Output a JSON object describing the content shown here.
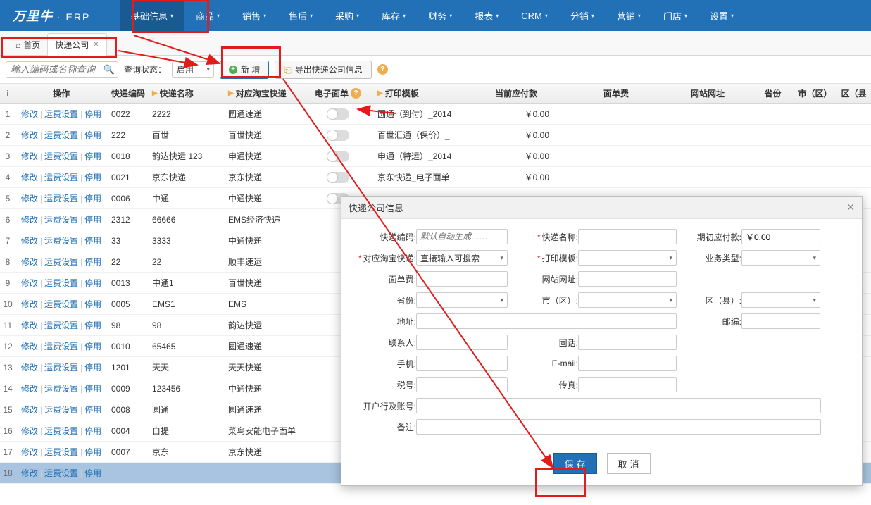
{
  "app": {
    "logo": "万里牛",
    "sub": "· ERP"
  },
  "nav": [
    "基础信息",
    "商品",
    "销售",
    "售后",
    "采购",
    "库存",
    "财务",
    "报表",
    "CRM",
    "分销",
    "营销",
    "门店",
    "设置"
  ],
  "navActiveIndex": 0,
  "tabs": {
    "home": "首页",
    "current": "快递公司"
  },
  "toolbar": {
    "searchPlaceholder": "输入编码或名称查询",
    "statusLabel": "查询状态：",
    "statusValue": "启用",
    "addLabel": "新 增",
    "exportLabel": "导出快递公司信息"
  },
  "columns": {
    "op": "操作",
    "code": "快递编码",
    "name": "快递名称",
    "tb": "对应淘宝快递",
    "ed": "电子面单",
    "tmpl": "打印模板",
    "pay": "当前应付款",
    "sheet": "面单费",
    "url": "网站网址",
    "prov": "省份",
    "city": "市（区）",
    "county": "区（县"
  },
  "ops": {
    "edit": "修改",
    "fee": "运费设置",
    "stop": "停用"
  },
  "rows": [
    {
      "idx": 1,
      "code": "0022",
      "name": "2222",
      "tb": "圆通速递",
      "tmpl": "圆通（到付）_2014",
      "pay": "￥0.00"
    },
    {
      "idx": 2,
      "code": "222",
      "name": "百世",
      "tb": "百世快递",
      "tmpl": "百世汇通（保价）_",
      "pay": "￥0.00"
    },
    {
      "idx": 3,
      "code": "0018",
      "name": "韵达快运 123",
      "tb": "申通快递",
      "tmpl": "申通（特运）_2014",
      "pay": "￥0.00"
    },
    {
      "idx": 4,
      "code": "0021",
      "name": "京东快递",
      "tb": "京东快递",
      "tmpl": "京东快递_电子面单",
      "pay": "￥0.00"
    },
    {
      "idx": 5,
      "code": "0006",
      "name": "中通",
      "tb": "中通快递",
      "tmpl": "",
      "pay": ""
    },
    {
      "idx": 6,
      "code": "2312",
      "name": "66666",
      "tb": "EMS经济快递",
      "tmpl": "",
      "pay": ""
    },
    {
      "idx": 7,
      "code": "33",
      "name": "3333",
      "tb": "中通快递",
      "tmpl": "",
      "pay": ""
    },
    {
      "idx": 8,
      "code": "22",
      "name": "22",
      "tb": "顺丰速运",
      "tmpl": "",
      "pay": ""
    },
    {
      "idx": 9,
      "code": "0013",
      "name": "中通1",
      "tb": "百世快递",
      "tmpl": "",
      "pay": ""
    },
    {
      "idx": 10,
      "code": "0005",
      "name": "EMS1",
      "tb": "EMS",
      "tmpl": "",
      "pay": ""
    },
    {
      "idx": 11,
      "code": "98",
      "name": "98",
      "tb": "韵达快运",
      "tmpl": "",
      "pay": ""
    },
    {
      "idx": 12,
      "code": "0010",
      "name": "65465",
      "tb": "圆通速递",
      "tmpl": "",
      "pay": ""
    },
    {
      "idx": 13,
      "code": "1201",
      "name": "天天",
      "tb": "天天快递",
      "tmpl": "",
      "pay": ""
    },
    {
      "idx": 14,
      "code": "0009",
      "name": "123456",
      "tb": "中通快递",
      "tmpl": "",
      "pay": ""
    },
    {
      "idx": 15,
      "code": "0008",
      "name": "圆通",
      "tb": "圆通速递",
      "tmpl": "",
      "pay": ""
    },
    {
      "idx": 16,
      "code": "0004",
      "name": "自提",
      "tb": "菜鸟安能电子面单",
      "tmpl": "",
      "pay": ""
    },
    {
      "idx": 17,
      "code": "0007",
      "name": "京东",
      "tb": "京东快递",
      "tmpl": "",
      "pay": ""
    },
    {
      "idx": 18,
      "code": "",
      "name": "",
      "tb": "",
      "tmpl": "",
      "pay": "",
      "selected": true
    }
  ],
  "modal": {
    "title": "快递公司信息",
    "labels": {
      "code": "快递编码:",
      "codePh": "默认自动生成……",
      "name": "快递名称:",
      "initPay": "期初应付款:",
      "initPayVal": "￥0.00",
      "tb": "对应淘宝快递:",
      "tbPh": "直接输入可搜索",
      "tmpl": "打印模板:",
      "biz": "业务类型:",
      "sheet": "面单费:",
      "url": "网站网址:",
      "prov": "省份:",
      "city": "市（区）:",
      "county": "区（县）:",
      "addr": "地址:",
      "zip": "邮编:",
      "contact": "联系人:",
      "tel": "固话:",
      "mobile": "手机:",
      "email": "E-mail:",
      "tax": "税号:",
      "fax": "传真:",
      "bank": "开户行及账号:",
      "remark": "备注:"
    },
    "save": "保存",
    "cancel": "取消"
  }
}
